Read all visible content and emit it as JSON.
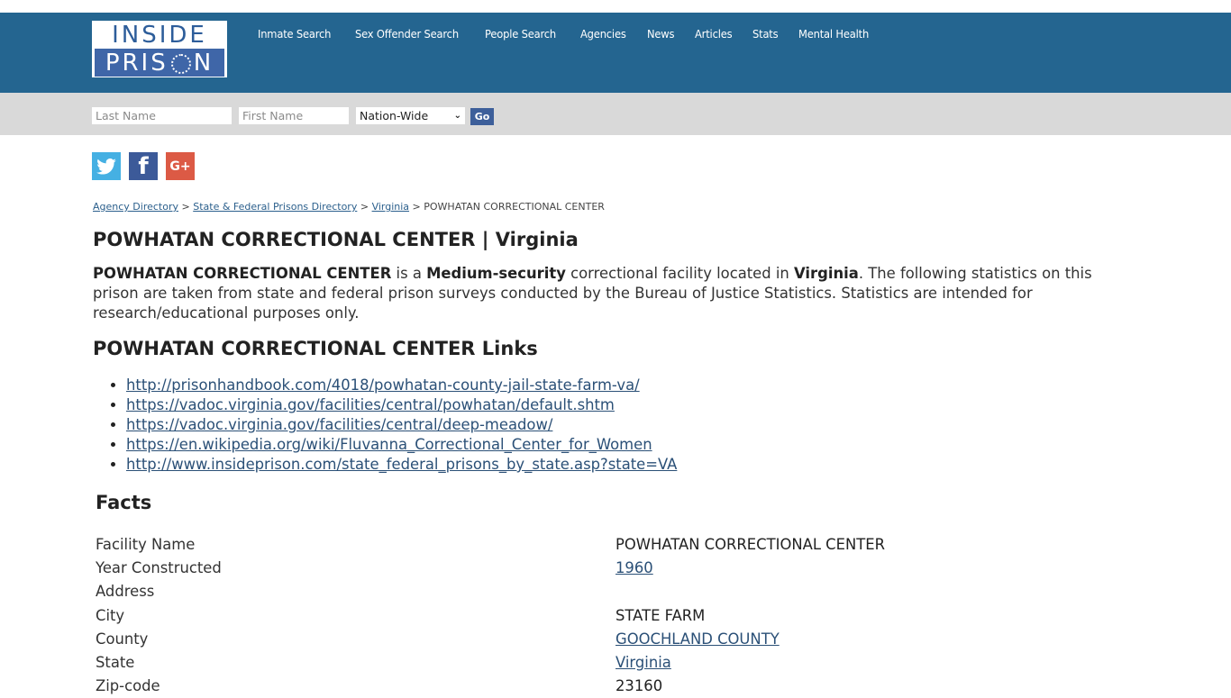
{
  "brand": {
    "logo_top": "INSIDE",
    "logo_bottom_pre": "PRIS",
    "logo_bottom_post": "N",
    "header_color": "#246590"
  },
  "nav": {
    "items": [
      "Inmate Search",
      "Sex Offender Search",
      "People Search",
      "Agencies",
      "News",
      "Articles",
      "Stats",
      "Mental Health"
    ]
  },
  "search": {
    "last_name_placeholder": "Last Name",
    "first_name_placeholder": "First Name",
    "scope_selected": "Nation-Wide",
    "go_label": "Go"
  },
  "social": {
    "twitter": "twitter-icon",
    "facebook": "facebook-icon",
    "google_plus": "google-plus-icon",
    "facebook_glyph": "f",
    "google_plus_glyph": "G+"
  },
  "breadcrumb": {
    "items": [
      "Agency Directory",
      "State & Federal Prisons Directory",
      "Virginia"
    ],
    "separator": ">",
    "current": "POWHATAN CORRECTIONAL CENTER"
  },
  "page": {
    "title": "POWHATAN CORRECTIONAL CENTER | Virginia",
    "intro": {
      "facility": "POWHATAN CORRECTIONAL CENTER",
      "t1": " is a ",
      "security": "Medium-security",
      "t2": " correctional facility located in ",
      "state": "Virginia",
      "t3": ". The following statistics on this prison are taken from state and federal prison surveys conducted by the Bureau of Justice Statistics. Statistics are intended for research/educational purposes only."
    },
    "links_title": "POWHATAN CORRECTIONAL CENTER Links",
    "links": [
      "http://prisonhandbook.com/4018/powhatan-county-jail-state-farm-va/",
      "https://vadoc.virginia.gov/facilities/central/powhatan/default.shtm",
      "https://vadoc.virginia.gov/facilities/central/deep-meadow/",
      "https://en.wikipedia.org/wiki/Fluvanna_Correctional_Center_for_Women",
      "http://www.insideprison.com/state_federal_prisons_by_state.asp?state=VA"
    ],
    "facts_title": "Facts",
    "facts": [
      {
        "label": "Facility Name",
        "value": "POWHATAN CORRECTIONAL CENTER",
        "link": false
      },
      {
        "label": "Year Constructed",
        "value": "1960",
        "link": true
      },
      {
        "label": "Address",
        "value": "",
        "link": false
      },
      {
        "label": "City",
        "value": "STATE FARM",
        "link": false
      },
      {
        "label": "County",
        "value": "GOOCHLAND COUNTY",
        "link": true
      },
      {
        "label": "State",
        "value": "Virginia",
        "link": true
      },
      {
        "label": "Zip-code",
        "value": "23160",
        "link": false
      }
    ]
  }
}
